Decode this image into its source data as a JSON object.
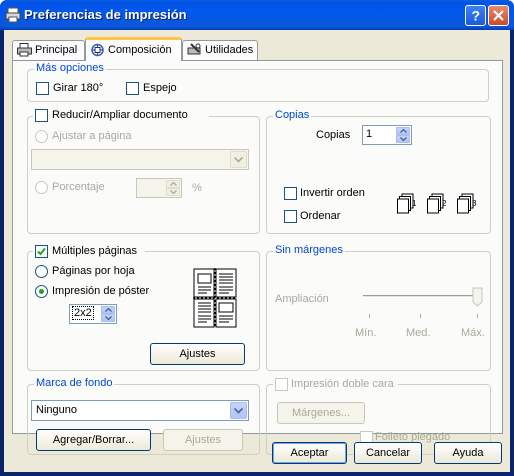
{
  "window": {
    "title": "Preferencias de impresión"
  },
  "tabs": [
    {
      "label": "Principal",
      "icon": "printer-icon"
    },
    {
      "label": "Composición",
      "icon": "layout-icon",
      "active": true
    },
    {
      "label": "Utilidades",
      "icon": "tools-icon"
    }
  ],
  "mas_opciones": {
    "title": "Más opciones",
    "girar": "Girar 180°",
    "espejo": "Espejo"
  },
  "reducir": {
    "title": "Reducir/Ampliar documento",
    "ajustar": "Ajustar a página",
    "porcentaje": "Porcentaje",
    "percent_sign": "%"
  },
  "copias": {
    "title": "Copias",
    "label": "Copias",
    "value": "1",
    "invertir": "Invertir orden",
    "ordenar": "Ordenar",
    "collate_icon": "collate-pages-icon",
    "collate_numbers": [
      "1",
      "2",
      "3"
    ]
  },
  "multiples": {
    "title": "Múltiples páginas",
    "checked": true,
    "paginas_por_hoja": "Páginas por hoja",
    "poster": "Impresión de póster",
    "poster_selected": true,
    "poster_value": "2x2",
    "ajustes": "Ajustes",
    "preview_icon": "poster-preview-icon"
  },
  "sin_margenes": {
    "title": "Sin márgenes",
    "ampliacion": "Ampliación",
    "slider_labels": [
      "Mín.",
      "Med.",
      "Máx."
    ],
    "slider_level": "Máx."
  },
  "marca_fondo": {
    "title": "Marca de fondo",
    "value": "Ninguno",
    "agregar": "Agregar/Borrar...",
    "ajustes": "Ajustes"
  },
  "doble_cara": {
    "title": "Impresión doble cara",
    "margenes": "Márgenes...",
    "folleto": "Folleto plegado"
  },
  "buttons": {
    "aceptar": "Aceptar",
    "cancelar": "Cancelar",
    "ayuda": "Ayuda"
  }
}
